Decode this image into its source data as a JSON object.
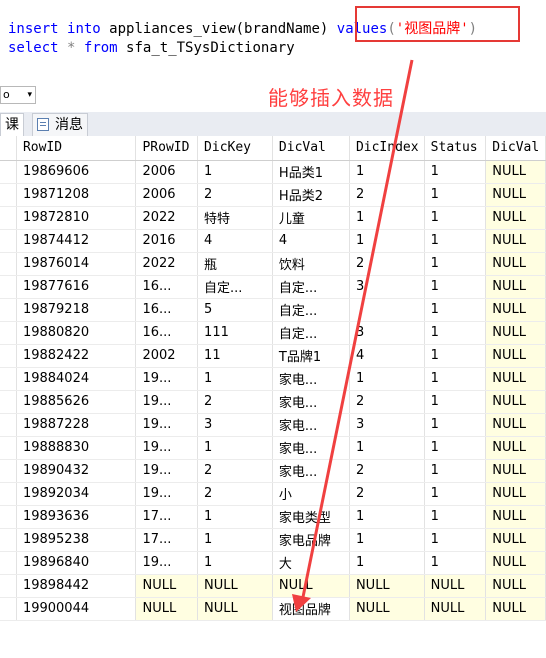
{
  "editor": {
    "line1": {
      "kw_insert": "insert",
      "kw_into": "into",
      "table_call": "appliances_view(brandName)",
      "kw_values": "values",
      "open": "(",
      "str": "'视图品牌'",
      "close": ")"
    },
    "line2": {
      "kw_select": "select",
      "star": "*",
      "kw_from": "from",
      "table": "sfa_t_TSysDictionary"
    }
  },
  "annotation": "能够插入数据",
  "toolbar": {
    "zoom_value": "o"
  },
  "tabs": {
    "results": "课",
    "messages": "消息"
  },
  "grid": {
    "columns": [
      "RowID",
      "PRowID",
      "DicKey",
      "DicVal",
      "DicIndex",
      "Status",
      "DicVal"
    ],
    "rows": [
      [
        "19869606",
        "2006",
        "1",
        "H品类1",
        "1",
        "1",
        "NULL"
      ],
      [
        "19871208",
        "2006",
        "2",
        "H品类2",
        "2",
        "1",
        "NULL"
      ],
      [
        "19872810",
        "2022",
        "特特",
        "儿童",
        "1",
        "1",
        "NULL"
      ],
      [
        "19874412",
        "2016",
        "4",
        "4",
        "1",
        "1",
        "NULL"
      ],
      [
        "19876014",
        "2022",
        "瓶",
        "饮料",
        "2",
        "1",
        "NULL"
      ],
      [
        "19877616",
        "16...",
        "自定...",
        "自定...",
        "3",
        "1",
        "NULL"
      ],
      [
        "19879218",
        "16...",
        "5",
        "自定...",
        "",
        "1",
        "NULL"
      ],
      [
        "19880820",
        "16...",
        "111",
        "自定...",
        "3",
        "1",
        "NULL"
      ],
      [
        "19882422",
        "2002",
        "11",
        "T品牌1",
        "4",
        "1",
        "NULL"
      ],
      [
        "19884024",
        "19...",
        "1",
        "家电...",
        "1",
        "1",
        "NULL"
      ],
      [
        "19885626",
        "19...",
        "2",
        "家电...",
        "2",
        "1",
        "NULL"
      ],
      [
        "19887228",
        "19...",
        "3",
        "家电...",
        "3",
        "1",
        "NULL"
      ],
      [
        "19888830",
        "19...",
        "1",
        "家电...",
        "1",
        "1",
        "NULL"
      ],
      [
        "19890432",
        "19...",
        "2",
        "家电...",
        "2",
        "1",
        "NULL"
      ],
      [
        "19892034",
        "19...",
        "2",
        "小",
        "2",
        "1",
        "NULL"
      ],
      [
        "19893636",
        "17...",
        "1",
        "家电类型",
        "1",
        "1",
        "NULL"
      ],
      [
        "19895238",
        "17...",
        "1",
        "家电品牌",
        "1",
        "1",
        "NULL"
      ],
      [
        "19896840",
        "19...",
        "1",
        "大",
        "1",
        "1",
        "NULL"
      ],
      [
        "19898442",
        "NULL",
        "NULL",
        "NULL",
        "NULL",
        "NULL",
        "NULL"
      ],
      [
        "19900044",
        "NULL",
        "NULL",
        "视图品牌",
        "NULL",
        "NULL",
        "NULL"
      ]
    ]
  },
  "colors": {
    "annotation": "#ff4040",
    "keyword": "#0000ff",
    "null_cell": "#fffee1"
  }
}
